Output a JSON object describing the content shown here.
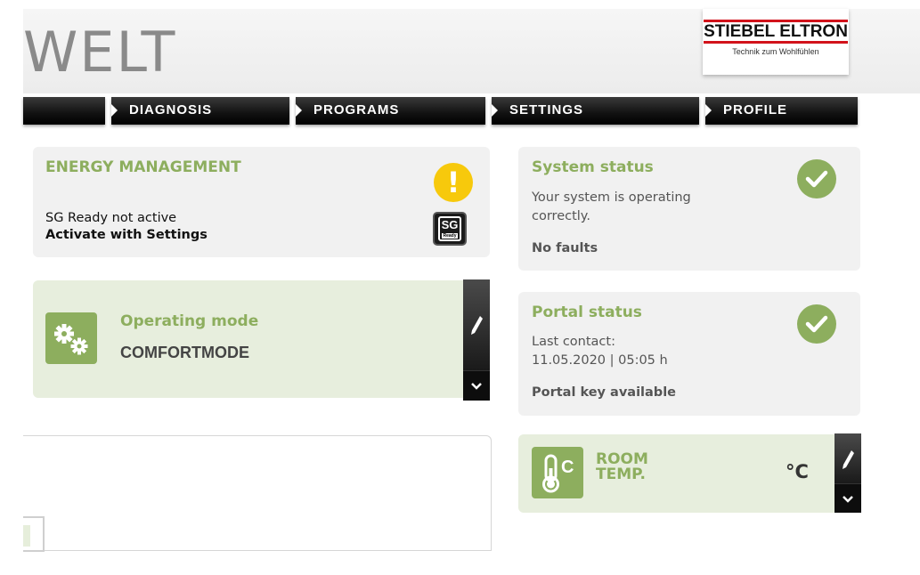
{
  "header": {
    "brand_title": "WELT",
    "logo_main": "STIEBEL ELTRON",
    "logo_sub": "Technik zum Wohlfühlen"
  },
  "nav": {
    "tabs": [
      {
        "label": ""
      },
      {
        "label": "DIAGNOSIS"
      },
      {
        "label": "PROGRAMS"
      },
      {
        "label": "SETTINGS"
      },
      {
        "label": "PROFILE"
      }
    ]
  },
  "energy": {
    "title": "ENERGY MANAGEMENT",
    "status": "SG Ready not active",
    "action": "Activate with Settings",
    "warn_symbol": "!",
    "sg_label": "SG",
    "sg_sub": "Ready"
  },
  "operating_mode": {
    "title": "Operating mode",
    "value": "COMFORTMODE"
  },
  "system_status": {
    "title": "System status",
    "message": "Your system is operating correctly.",
    "faults": "No faults"
  },
  "portal_status": {
    "title": "Portal status",
    "last_contact_label": "Last contact:",
    "last_contact_value": "11.05.2020 | 05:05 h",
    "key": "Portal key available"
  },
  "room_temp": {
    "title_line1": "ROOM",
    "title_line2": "TEMP.",
    "unit": "°C",
    "icon_letter": "C"
  },
  "colors": {
    "accent_green": "#8dae5e",
    "warning_yellow": "#f7c90c",
    "nav_black": "#111111"
  }
}
